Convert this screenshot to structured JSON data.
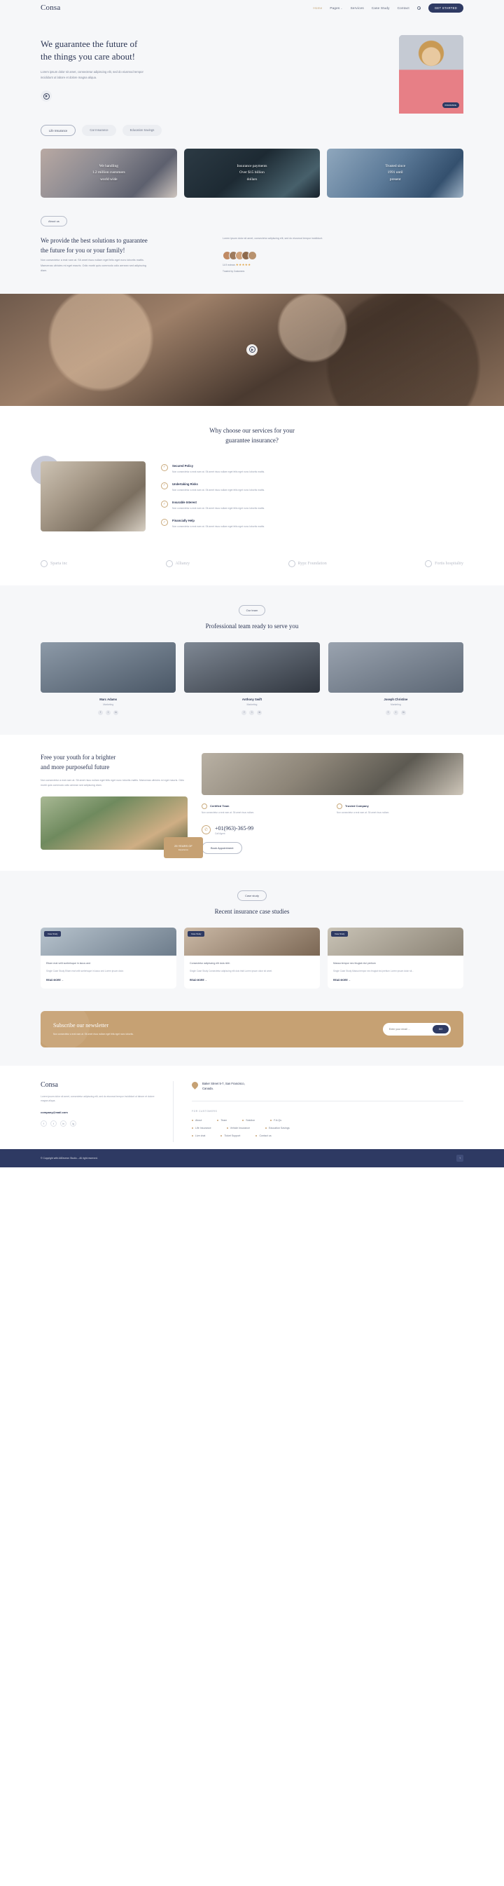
{
  "brand": {
    "name": "Consa",
    "accent": "#c6a173",
    "navy": "#2e3a63"
  },
  "header": {
    "nav": [
      {
        "label": "Home",
        "active": true
      },
      {
        "label": "Pages",
        "caret": "⌄"
      },
      {
        "label": "Services"
      },
      {
        "label": "Case Study"
      },
      {
        "label": "Contact"
      }
    ],
    "search_icon": "search-icon",
    "cta": "GET STARTED"
  },
  "hero": {
    "title_l1": "We guarantee the future of",
    "title_l2": "the things you care about!",
    "paragraph": "Lorem ipsum dolor sit amet, consectetur adipiscing elit, sed do eiusmod tempor incididunt ut labore et dolore magna aliqua.",
    "play_icon": "play-circle-icon",
    "pills": [
      "Life Insurance",
      "Car Insurance",
      "Education Savings"
    ],
    "image_badge": "INSURANCE"
  },
  "cards": [
    {
      "l1": "We handling",
      "l2": "1.2 million customers",
      "l3": "world wide"
    },
    {
      "l1": "Insurance payments",
      "l2": "Over $15 billion",
      "l3": "dollars"
    },
    {
      "l1": "Trusted since",
      "l2": "1991 until",
      "l3": "present"
    }
  ],
  "about": {
    "tag": "About us",
    "title_l1": "We provide the best solutions to guarantee",
    "title_l2": "the future for you or your family!",
    "paragraph": "Non consectetur a erat nam at. Sit amet risus nullam eget felis eget nunc lobortis mattis. Maecenas ultricies mi eget mauris. Odio morbi quis commodo odio aenean sed adipiscing diam.",
    "right_text": "Lorem ipsum dolor sit amet, consectetur adipiscing elit, sed do eiusmod tempor incididunt.",
    "rating": "14.9 reviews",
    "stars": "★★★★★",
    "trusted": "Trusted by Customers"
  },
  "why": {
    "title_l1": "Why choose our services for your",
    "title_l2": "guarantee insurance?",
    "benefits": [
      {
        "title": "Secured Policy",
        "desc": "Non consectetur a erat nam at. Sit amet risus nullam eget felis eget nunc lobortis mattis."
      },
      {
        "title": "Undertaking Risks",
        "desc": "Non consectetur a erat nam at. Sit amet risus nullam eget felis eget nunc lobortis mattis."
      },
      {
        "title": "Insurable Interest",
        "desc": "Non consectetur a erat nam at. Sit amet risus nullam eget felis eget nunc lobortis mattis."
      },
      {
        "title": "Financially Help",
        "desc": "Non consectetur a erat nam at. Sit amet risus nullam eget felis eget nunc lobortis mattis."
      }
    ],
    "check_icon": "check-circle-icon"
  },
  "brands": [
    {
      "name": "Sparta inc",
      "icon": "sparta-logo-icon"
    },
    {
      "name": "Allianzy",
      "icon": "allianzy-logo-icon"
    },
    {
      "name": "Rypz Foundation",
      "icon": "rypz-logo-icon"
    },
    {
      "name": "Fortis hospitality",
      "icon": "fortis-logo-icon"
    }
  ],
  "team": {
    "tag": "Our team",
    "title": "Professional team ready to serve you",
    "members": [
      {
        "name": "Marc Adams",
        "role": "Marketing"
      },
      {
        "name": "Anthony Swift",
        "role": "Marketing"
      },
      {
        "name": "Joseph Christine",
        "role": "Marketing"
      }
    ],
    "socials": [
      "f",
      "t",
      "in"
    ]
  },
  "youth": {
    "title_l1": "Free your youth for a brighter",
    "title_l2": "and more purposeful future",
    "paragraph": "Non consectetur a erat nam at. Sit amet risus nullam eget felis eget nunc lobortis mattis. Maecenas ultricies mi eget mauris. Odio morbi quis commodo odio aenean sed adipiscing diam.",
    "years_number": "25 YEARS OF",
    "years_label": "Experience",
    "features": [
      {
        "title": "Certified Team",
        "desc": "Non consectetur a erat nam at. Sit amet risus nullam.",
        "icon": "handshake-icon"
      },
      {
        "title": "Trusted Company",
        "desc": "Non consectetur a erat nam at. Sit amet risus nullam.",
        "icon": "shield-icon"
      }
    ],
    "phone": "+01(963)-365-99",
    "phone_label": "Call Agent",
    "phone_icon": "phone-icon",
    "button": "Book Appointment"
  },
  "case_study": {
    "tag": "Case study",
    "title": "Recent insurance case studies",
    "items": [
      {
        "badge": "Case Study",
        "text_l1": "Etiam erat velit scelerisque in lacus and",
        "text_l2": "Single Case Study Etiam erat velit scelerisque in lacus sed Lorem ipsum dolor.",
        "more": "READ MORE"
      },
      {
        "badge": "Case Study",
        "text_l1": "Consectetur adipiscing elit duis nibh",
        "text_l2": "Single Case Study Consectetur adipiscing elit duis tristi Lorem ipsum dolor sit amet.",
        "more": "READ MORE"
      },
      {
        "badge": "Case Study",
        "text_l1": "Massa tempor nec feugiat nisl pretium",
        "text_l2": "Single Case Study Massa tempor nec feugiat nisl pretium Lorem ipsum dolor sit...",
        "more": "READ MORE"
      }
    ]
  },
  "newsletter": {
    "title": "Subscribe our newsletter",
    "paragraph": "Non consectetur a erat nam at. Sit amet risus nullam eget felis eget nunc lobortis.",
    "placeholder": "Enter your email ...",
    "button": "GO"
  },
  "footer": {
    "logo": "Consa",
    "paragraph": "Lorem ipsum dolor sit amet, consectetur adipiscing elit, sed do eiusmod tempor incididunt ut labore et dolore magna aliqua.",
    "email": "company@mail.com",
    "socials": [
      "f",
      "t",
      "in",
      "ig"
    ],
    "address_l1": "Baker Street 5-7, San Francisco,",
    "address_l2": "Canada.",
    "links_title": "FOR CUSTOMERS",
    "links_row1": [
      "About",
      "Team",
      "Solution",
      "F.A.Qs"
    ],
    "links_row2": [
      "Life Insurance",
      "Vehicle Insurance",
      "Education Savings"
    ],
    "links_row3": [
      "Live chat",
      "Ticket Support",
      "Contact us"
    ],
    "copyright": "© Copyright with AliDevmm Studio – All right reserved.",
    "to_top_icon": "arrow-up-icon"
  }
}
